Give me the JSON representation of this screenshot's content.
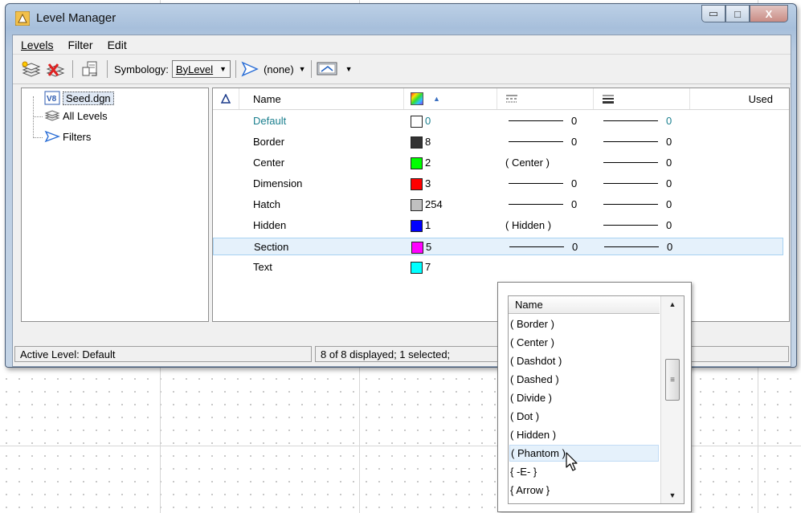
{
  "window": {
    "title": "Level Manager",
    "min_glyph": "▭",
    "max_glyph": "□",
    "close_glyph": "X"
  },
  "menu": {
    "levels": "Levels",
    "filter": "Filter",
    "edit": "Edit"
  },
  "toolbar": {
    "symbology_label": "Symbology:",
    "symbology_value": "ByLevel",
    "filter_value": "(none)"
  },
  "tree": {
    "seed": "Seed.dgn",
    "all_levels": "All Levels",
    "filters": "Filters"
  },
  "columns": {
    "name": "Name",
    "used": "Used"
  },
  "levels": [
    {
      "name": "Default",
      "color": "#ffffff",
      "color_num": "0",
      "style": "0",
      "weight": "0",
      "active": true
    },
    {
      "name": "Border",
      "color": "#333333",
      "color_num": "8",
      "style": "0",
      "weight": "0"
    },
    {
      "name": "Center",
      "color": "#00ff00",
      "color_num": "2",
      "style": "( Center )",
      "weight": "0"
    },
    {
      "name": "Dimension",
      "color": "#ff0000",
      "color_num": "3",
      "style": "0",
      "weight": "0"
    },
    {
      "name": "Hatch",
      "color": "#c0c0c0",
      "color_num": "254",
      "style": "0",
      "weight": "0"
    },
    {
      "name": "Hidden",
      "color": "#0000ff",
      "color_num": "1",
      "style": "( Hidden )",
      "weight": "0"
    },
    {
      "name": "Section",
      "color": "#ff00ff",
      "color_num": "5",
      "style": "0",
      "weight": "0",
      "selected": true
    },
    {
      "name": "Text",
      "color": "#00ffff",
      "color_num": "7",
      "style": "",
      "weight": ""
    }
  ],
  "status": {
    "active_level": "Active Level: Default",
    "display_count": "8 of 8 displayed; 1 selected;"
  },
  "popup": {
    "header": "Name",
    "items": [
      "( Border )",
      "( Center )",
      "( Dashdot )",
      "( Dashed )",
      "( Divide )",
      "( Dot )",
      "( Hidden )",
      "( Phantom )",
      "{ -E- }",
      "{ Arrow }"
    ],
    "hovered": "( Phantom )",
    "scrollbar_fraction": 0.3
  },
  "colors": {
    "active_level_text": "#1a7f8e",
    "selection_bg": "#e5f1fb"
  }
}
